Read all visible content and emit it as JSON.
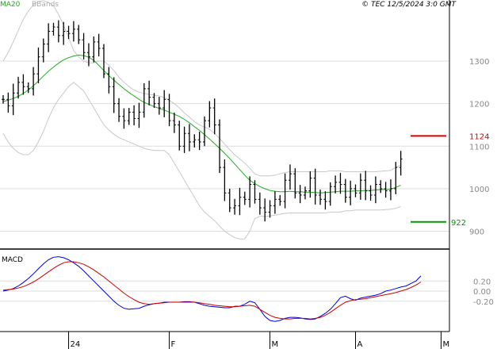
{
  "header": {
    "ma_label": "MA20",
    "bb_label": "BBands",
    "copyright": "© TEC 12/5/2024 3:0 GMT"
  },
  "colors": {
    "price": "#000000",
    "ma": "#22aa22",
    "bands": "#c8c8c8",
    "grid": "#dddddd",
    "resistance": "#dd0000",
    "support": "#009900",
    "macd": "#0000dd",
    "signal": "#cc0000",
    "axis": "#000000",
    "ma_label": "#22aa22",
    "bb_label": "#aaaaaa"
  },
  "chart_data": [
    {
      "type": "ohlc",
      "y_axis": {
        "ticks": [
          900,
          1000,
          1100,
          1200,
          1300
        ],
        "labels": [
          "900",
          "1000",
          "1100",
          "1200",
          "1300"
        ],
        "ylim": [
          860,
          1425
        ]
      },
      "x_axis": {
        "labels": [
          "24",
          "F",
          "M",
          "A",
          "M"
        ],
        "label_index": [
          13,
          33,
          53,
          70,
          87
        ]
      },
      "levels": {
        "resistance": 1124,
        "resistance_label": "1124",
        "support": 922,
        "support_label": "922"
      },
      "close": [
        1210,
        1195,
        1225,
        1250,
        1240,
        1235,
        1270,
        1310,
        1340,
        1370,
        1380,
        1360,
        1370,
        1365,
        1375,
        1350,
        1320,
        1310,
        1345,
        1330,
        1270,
        1240,
        1200,
        1170,
        1160,
        1180,
        1165,
        1180,
        1235,
        1215,
        1200,
        1190,
        1210,
        1160,
        1150,
        1100,
        1130,
        1110,
        1115,
        1110,
        1160,
        1190,
        1150,
        1050,
        990,
        955,
        960,
        980,
        975,
        1010,
        975,
        955,
        945,
        960,
        975,
        970,
        1020,
        1035,
        990,
        985,
        995,
        1025,
        985,
        975,
        970,
        1005,
        1015,
        1010,
        980,
        1000,
        990,
        1020,
        995,
        985,
        1010,
        1000,
        995,
        1000,
        1050,
        1070
      ],
      "ma": [
        1205,
        1208,
        1212,
        1217,
        1224,
        1232,
        1242,
        1253,
        1265,
        1276,
        1286,
        1295,
        1303,
        1308,
        1312,
        1314,
        1313,
        1309,
        1302,
        1290,
        1278,
        1266,
        1255,
        1245,
        1235,
        1226,
        1218,
        1210,
        1203,
        1198,
        1193,
        1189,
        1185,
        1180,
        1175,
        1170,
        1163,
        1155,
        1146,
        1137,
        1127,
        1117,
        1106,
        1095,
        1083,
        1071,
        1058,
        1045,
        1032,
        1020,
        1012,
        1005,
        1000,
        996,
        994,
        993,
        993,
        994,
        993,
        993,
        992,
        992,
        991,
        990,
        991,
        992,
        993,
        994,
        994,
        994,
        995,
        995,
        996,
        996,
        997,
        998,
        998,
        999,
        1003,
        1008
      ],
      "bb_upper": [
        1300,
        1320,
        1345,
        1372,
        1398,
        1418,
        1432,
        1440,
        1442,
        1438,
        1430,
        1410,
        1385,
        1355,
        1325,
        1310,
        1300,
        1296,
        1296,
        1300,
        1300,
        1290,
        1278,
        1262,
        1250,
        1240,
        1232,
        1227,
        1224,
        1222,
        1220,
        1218,
        1214,
        1208,
        1200,
        1190,
        1178,
        1168,
        1158,
        1150,
        1145,
        1140,
        1130,
        1118,
        1105,
        1092,
        1080,
        1070,
        1060,
        1048,
        1035,
        1030,
        1030,
        1030,
        1032,
        1035,
        1038,
        1040,
        1040,
        1040,
        1040,
        1040,
        1040,
        1040,
        1040,
        1042,
        1042,
        1042,
        1040,
        1040,
        1040,
        1040,
        1040,
        1040,
        1040,
        1041,
        1042,
        1043,
        1050,
        1056
      ],
      "bb_lower": [
        1130,
        1110,
        1095,
        1085,
        1080,
        1080,
        1090,
        1110,
        1135,
        1165,
        1190,
        1210,
        1225,
        1240,
        1250,
        1240,
        1230,
        1210,
        1190,
        1170,
        1150,
        1138,
        1128,
        1120,
        1115,
        1110,
        1105,
        1100,
        1095,
        1092,
        1090,
        1090,
        1090,
        1080,
        1060,
        1040,
        1020,
        1000,
        980,
        960,
        945,
        935,
        925,
        912,
        900,
        892,
        885,
        882,
        882,
        900,
        930,
        935,
        935,
        936,
        938,
        940,
        942,
        943,
        943,
        943,
        943,
        943,
        943,
        943,
        943,
        945,
        945,
        945,
        948,
        948,
        950,
        950,
        950,
        950,
        950,
        950,
        951,
        952,
        954,
        958
      ]
    },
    {
      "type": "line",
      "title": "MACD",
      "y_axis": {
        "ticks": [
          0.2,
          0,
          -0.2
        ],
        "labels": [
          "0.20",
          "0.00",
          "-0.20"
        ],
        "ylim": [
          -0.8,
          0.8
        ]
      },
      "series": [
        {
          "values": [
            0,
            0.02,
            0.05,
            0.1,
            0.17,
            0.25,
            0.34,
            0.44,
            0.54,
            0.62,
            0.67,
            0.68,
            0.66,
            0.62,
            0.56,
            0.49,
            0.4,
            0.3,
            0.2,
            0.1,
            0,
            -0.1,
            -0.2,
            -0.28,
            -0.34,
            -0.36,
            -0.35,
            -0.34,
            -0.3,
            -0.27,
            -0.25,
            -0.24,
            -0.22,
            -0.22,
            -0.22,
            -0.22,
            -0.21,
            -0.21,
            -0.22,
            -0.25,
            -0.28,
            -0.3,
            -0.31,
            -0.32,
            -0.33,
            -0.33,
            -0.3,
            -0.3,
            -0.26,
            -0.2,
            -0.23,
            -0.36,
            -0.5,
            -0.58,
            -0.6,
            -0.58,
            -0.54,
            -0.52,
            -0.52,
            -0.53,
            -0.55,
            -0.56,
            -0.55,
            -0.5,
            -0.44,
            -0.36,
            -0.25,
            -0.13,
            -0.1,
            -0.15,
            -0.18,
            -0.14,
            -0.12,
            -0.1,
            -0.08,
            -0.05,
            0,
            0.02,
            0.05,
            0.08,
            0.1,
            0.15,
            0.2,
            0.3
          ]
        },
        {
          "values": [
            0.02,
            0.03,
            0.04,
            0.06,
            0.09,
            0.13,
            0.18,
            0.24,
            0.31,
            0.38,
            0.45,
            0.51,
            0.56,
            0.58,
            0.58,
            0.56,
            0.53,
            0.48,
            0.42,
            0.35,
            0.28,
            0.2,
            0.12,
            0.04,
            -0.04,
            -0.11,
            -0.17,
            -0.22,
            -0.25,
            -0.26,
            -0.25,
            -0.24,
            -0.23,
            -0.22,
            -0.22,
            -0.22,
            -0.22,
            -0.22,
            -0.22,
            -0.23,
            -0.25,
            -0.26,
            -0.28,
            -0.29,
            -0.3,
            -0.31,
            -0.31,
            -0.3,
            -0.29,
            -0.28,
            -0.3,
            -0.36,
            -0.42,
            -0.48,
            -0.52,
            -0.54,
            -0.55,
            -0.55,
            -0.54,
            -0.54,
            -0.54,
            -0.55,
            -0.54,
            -0.52,
            -0.48,
            -0.42,
            -0.35,
            -0.28,
            -0.22,
            -0.19,
            -0.17,
            -0.16,
            -0.15,
            -0.13,
            -0.11,
            -0.09,
            -0.07,
            -0.05,
            -0.03,
            0,
            0.03,
            0.07,
            0.12,
            0.18
          ]
        }
      ]
    }
  ]
}
